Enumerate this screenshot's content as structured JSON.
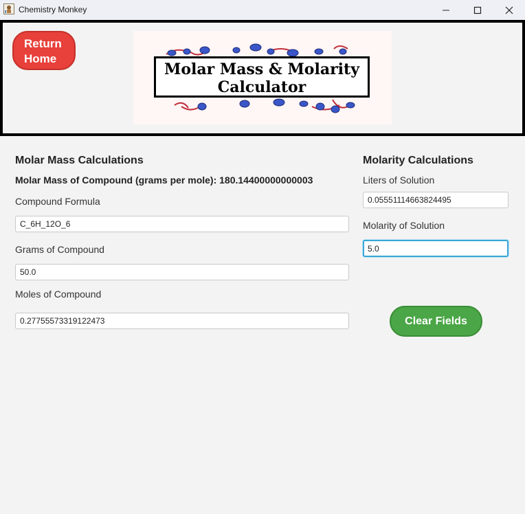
{
  "window": {
    "title": "Chemistry Monkey",
    "app_icon": "chemistry-monkey-icon",
    "minimize_icon": "minimize-icon",
    "maximize_icon": "maximize-icon",
    "close_icon": "close-icon"
  },
  "header": {
    "return_line1": "Return",
    "return_line2": "Home",
    "logo_line1": "Molar Mass & Molarity",
    "logo_line2": "Calculator"
  },
  "molar_mass": {
    "heading": "Molar Mass Calculations",
    "result": "Molar Mass of Compound (grams per mole): 180.14400000000003",
    "formula_label": "Compound Formula",
    "formula_value": "C_6H_12O_6",
    "grams_label": "Grams of Compound",
    "grams_value": "50.0",
    "moles_label": "Moles of Compound",
    "moles_value": "0.27755573319122473"
  },
  "molarity": {
    "heading": "Molarity Calculations",
    "liters_label": "Liters of Solution",
    "liters_value": "0.05551114663824495",
    "molarity_label": "Molarity of Solution",
    "molarity_value": "5.0",
    "clear_label": "Clear Fields"
  },
  "colors": {
    "return_button": "#e8403a",
    "clear_button": "#4aa646",
    "focus_ring": "#37a6d8"
  }
}
